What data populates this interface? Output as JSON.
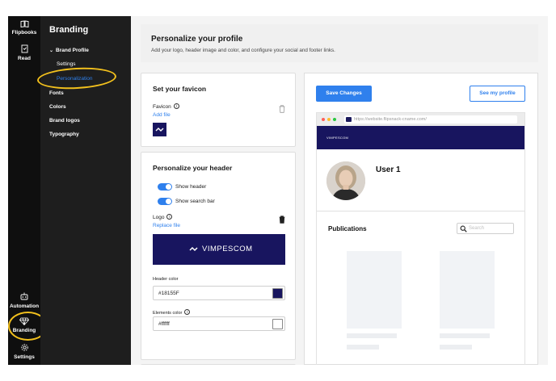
{
  "rail": {
    "flipbooks_label": "Flipbooks",
    "read_label": "Read",
    "automation_label": "Automation",
    "branding_label": "Branding",
    "settings_label": "Settings",
    "icons": [
      "book-icon",
      "read-icon",
      "automation-icon",
      "diamond-icon",
      "gear-icon"
    ]
  },
  "menu": {
    "title": "Branding",
    "brand_profile": "Brand Profile",
    "settings": "Settings",
    "personalization": "Personalization",
    "fonts": "Fonts",
    "colors": "Colors",
    "brand_logos": "Brand logos",
    "typography": "Typography"
  },
  "header": {
    "title": "Personalize your profile",
    "subtitle": "Add your logo, header image and color, and configure your social and footer links."
  },
  "favicon_card": {
    "title": "Set your favicon",
    "favicon_label": "Favicon",
    "add_file": "Add file"
  },
  "header_card": {
    "title": "Personalize your header",
    "show_header": "Show header",
    "show_search_bar": "Show search bar",
    "logo_label": "Logo",
    "replace_file": "Replace file",
    "logo_text": "VIMPESCOM",
    "header_color_label": "Header color",
    "header_color_value": "#18155F",
    "elements_color_label": "Elements color",
    "elements_color_value": "#ffffff"
  },
  "preview": {
    "save_button": "Save Changes",
    "see_profile_button": "See my profile",
    "url": "https://website.flipsnack-cname.com/",
    "band_logo_text": "VIMPESCOM",
    "user_name": "User 1",
    "publications_label": "Publications",
    "search_placeholder": "Search"
  },
  "colors": {
    "accent": "#2f80ed",
    "brand": "#18155f",
    "highlight": "#f2c01d",
    "sidebar": "#1e1e1e",
    "rail": "#0f0f0f"
  }
}
